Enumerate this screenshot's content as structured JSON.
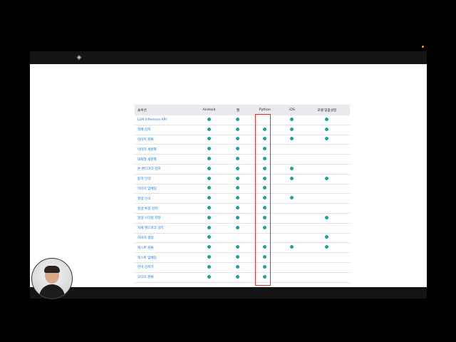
{
  "table": {
    "columns": [
      "솔루션",
      "Android",
      "웹",
      "Python",
      "iOS",
      "모델 맞춤설정"
    ],
    "rows": [
      {
        "name": "LLM Inference API",
        "flags": [
          true,
          true,
          false,
          true,
          true
        ]
      },
      {
        "name": "객체 감지",
        "flags": [
          true,
          true,
          true,
          true,
          true
        ]
      },
      {
        "name": "이미지 분류",
        "flags": [
          true,
          true,
          true,
          true,
          true
        ]
      },
      {
        "name": "이미지 세분화",
        "flags": [
          true,
          true,
          true,
          false,
          false
        ]
      },
      {
        "name": "대화형 세분화",
        "flags": [
          true,
          true,
          true,
          false,
          false
        ]
      },
      {
        "name": "손 랜드마크 감지",
        "flags": [
          true,
          true,
          true,
          true,
          false
        ]
      },
      {
        "name": "동작 인식",
        "flags": [
          true,
          true,
          true,
          true,
          true
        ]
      },
      {
        "name": "이미지 임베딩",
        "flags": [
          true,
          true,
          true,
          false,
          false
        ]
      },
      {
        "name": "얼굴 인식",
        "flags": [
          true,
          true,
          true,
          true,
          false
        ]
      },
      {
        "name": "얼굴 특징 감지",
        "flags": [
          true,
          true,
          true,
          false,
          false
        ]
      },
      {
        "name": "얼굴 스타일 지정",
        "flags": [
          true,
          true,
          true,
          false,
          true
        ]
      },
      {
        "name": "자세 랜드마크 감지",
        "flags": [
          true,
          true,
          true,
          false,
          false
        ]
      },
      {
        "name": "이미지 생성",
        "flags": [
          true,
          false,
          false,
          false,
          true
        ]
      },
      {
        "name": "텍스트 분류",
        "flags": [
          true,
          true,
          true,
          true,
          true
        ]
      },
      {
        "name": "텍스트 임베딩",
        "flags": [
          true,
          true,
          true,
          false,
          false
        ]
      },
      {
        "name": "언어 감지기",
        "flags": [
          true,
          true,
          true,
          false,
          false
        ]
      },
      {
        "name": "오디오 분류",
        "flags": [
          true,
          true,
          true,
          false,
          false
        ]
      }
    ]
  },
  "colors": {
    "dot": "#1aa59a",
    "highlight": "#d9342b",
    "link": "#1a73e8"
  },
  "icons": {
    "logo": "mediapipe-logo-icon"
  }
}
